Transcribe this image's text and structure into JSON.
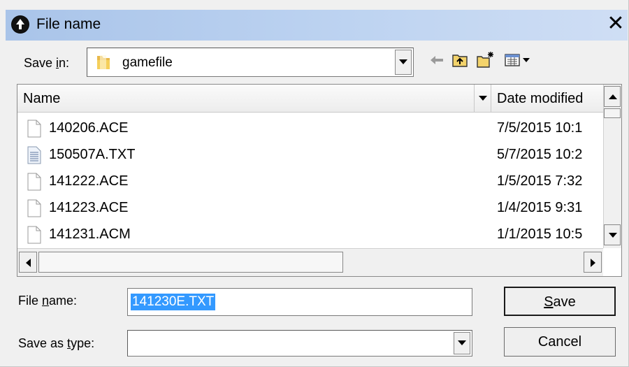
{
  "window": {
    "title": "File name",
    "close_glyph": "✕"
  },
  "save_in": {
    "label_prefix": "Save ",
    "label_accel": "i",
    "label_suffix": "n:",
    "value": "gamefile",
    "icon": "folder-icon"
  },
  "toolbar": {
    "icons": [
      "back-arrow-icon",
      "up-folder-icon",
      "new-folder-icon",
      "view-menu-icon"
    ]
  },
  "file_list": {
    "columns": {
      "name": "Name",
      "date": "Date modified"
    },
    "rows": [
      {
        "name": "140206.ACE",
        "date": "7/5/2015 10:1",
        "icon": "blank-document-icon"
      },
      {
        "name": "150507A.TXT",
        "date": "5/7/2015 10:2",
        "icon": "text-document-icon"
      },
      {
        "name": "141222.ACE",
        "date": "1/5/2015 7:32",
        "icon": "blank-document-icon"
      },
      {
        "name": "141223.ACE",
        "date": "1/4/2015 9:31",
        "icon": "blank-document-icon"
      },
      {
        "name": "141231.ACM",
        "date": "1/1/2015 10:5",
        "icon": "blank-document-icon"
      }
    ]
  },
  "file_name": {
    "label_prefix": "File ",
    "label_accel": "n",
    "label_suffix": "ame:",
    "value": "141230E.TXT"
  },
  "save_as_type": {
    "label_prefix": "Save as ",
    "label_accel": "t",
    "label_suffix": "ype:",
    "value": ""
  },
  "buttons": {
    "save_accel": "S",
    "save_rest": "ave",
    "cancel": "Cancel"
  }
}
